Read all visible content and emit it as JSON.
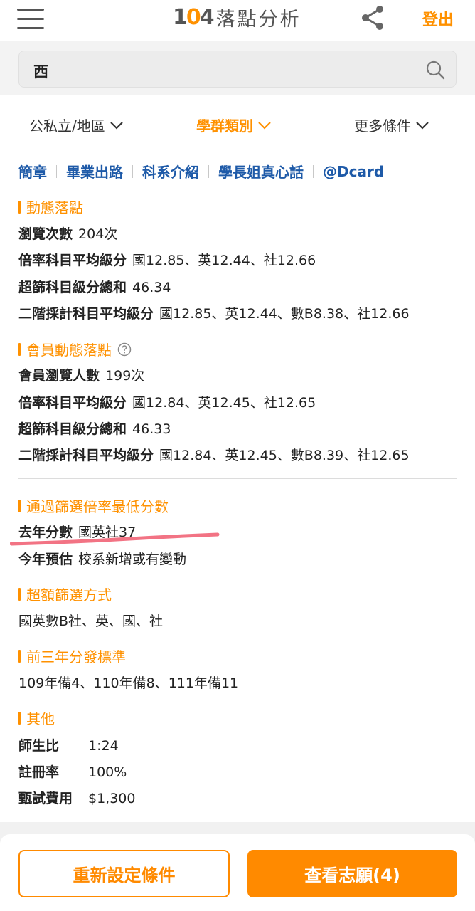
{
  "header": {
    "logo_num_a": "1",
    "logo_num_o": "0",
    "logo_num_b": "4",
    "logo_text": "落點分析",
    "logout_label": "登出"
  },
  "search": {
    "value": "西"
  },
  "filters": {
    "f1": "公私立/地區",
    "f2": "學群類別",
    "f3": "更多條件"
  },
  "links": [
    "簡章",
    "畢業出路",
    "科系介紹",
    "學長姐真心話",
    "@Dcard"
  ],
  "dynamic": {
    "title": "動態落點",
    "rows": [
      {
        "label": "瀏覽次數",
        "value": "204次"
      },
      {
        "label": "倍率科目平均級分",
        "value": "國12.85、英12.44、社12.66"
      },
      {
        "label": "超篩科目級分總和",
        "value": "46.34"
      },
      {
        "label": "二階採計科目平均級分",
        "value": "國12.85、英12.44、數B8.38、社12.66"
      }
    ]
  },
  "member": {
    "title": "會員動態落點",
    "rows": [
      {
        "label": "會員瀏覽人數",
        "value": "199次"
      },
      {
        "label": "倍率科目平均級分",
        "value": "國12.84、英12.45、社12.65"
      },
      {
        "label": "超篩科目級分總和",
        "value": "46.33"
      },
      {
        "label": "二階採計科目平均級分",
        "value": "國12.84、英12.45、數B8.39、社12.65"
      }
    ]
  },
  "pass": {
    "title": "通過篩選倍率最低分數",
    "rows": [
      {
        "label": "去年分數",
        "value": "國英社37"
      },
      {
        "label": "今年預估",
        "value": "校系新增或有變動"
      }
    ]
  },
  "excess": {
    "title": "超額篩選方式",
    "text": "國英數B社、英、國、社"
  },
  "standard": {
    "title": "前三年分發標準",
    "text": "109年備4、110年備8、111年備11"
  },
  "other": {
    "title": "其他",
    "rows": [
      {
        "label": "師生比",
        "value": "1:24"
      },
      {
        "label": "註冊率",
        "value": "100%"
      },
      {
        "label": "甄試費用",
        "value": "$1,300"
      }
    ]
  },
  "buttons": {
    "reset": "重新設定條件",
    "view": "查看志願(4)"
  },
  "colors": {
    "accent": "#ff9100",
    "link": "#1e5aa8",
    "highlight_underline": "#f05a6e"
  }
}
